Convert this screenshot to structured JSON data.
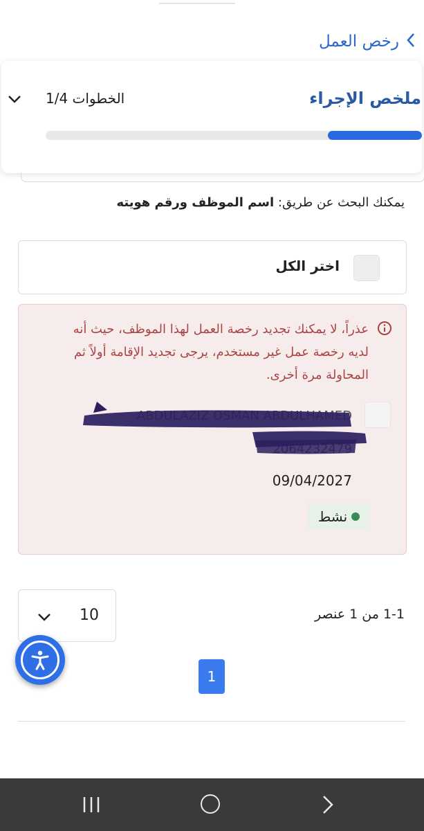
{
  "header": {
    "back_title": "رخص العمل"
  },
  "steps": {
    "title": "ملخص الإجراء",
    "count_label": "الخطوات 1/4",
    "progress_fraction": 0.25
  },
  "search_hint": {
    "prefix": "يمكنك البحث عن طريق:",
    "fields": "اسم الموظف ورقم هويته"
  },
  "select_all": {
    "label": "اختر الكل"
  },
  "employee": {
    "error_message": "عذراً، لا يمكنك تجديد رخصة العمل لهذا الموظف، حيث أنه لديه رخصة عمل غير مستخدم، يرجى تجديد الإقامة أولاً ثم المحاولة مرة أخرى.",
    "name": "ABDULAZIZ OSMAN ABDULHAMED",
    "id_number": "2064232479",
    "date": "09/04/2027",
    "status": "نشط"
  },
  "pagination": {
    "page_size": "10",
    "range_text": "1-1 من 1 عنصر",
    "current_page": "1"
  },
  "colors": {
    "accent": "#2a6ae0",
    "error_bg": "#f7ecec",
    "error_text": "#a94442",
    "status_dot": "#3a8a55",
    "navbar": "#3a3a3a"
  },
  "icons": [
    "chevron-right-icon",
    "chevron-down-icon",
    "info-icon",
    "accessibility-icon",
    "recent-apps-icon",
    "home-icon",
    "back-icon"
  ]
}
